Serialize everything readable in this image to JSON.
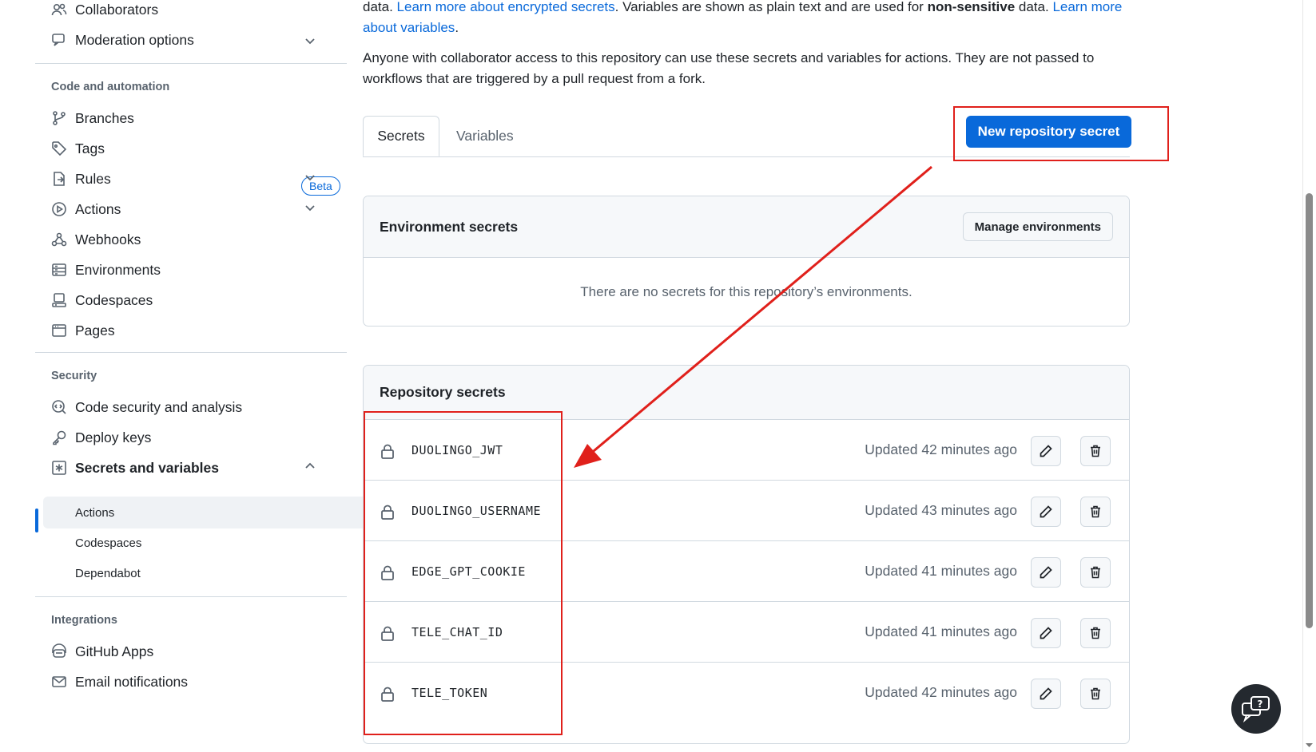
{
  "sidebar": {
    "top_items": [
      {
        "label": "Collaborators",
        "icon": "people-icon"
      },
      {
        "label": "Moderation options",
        "icon": "comment-icon"
      }
    ],
    "section_code": "Code and automation",
    "code_items": [
      {
        "label": "Branches",
        "icon": "git-branch-icon"
      },
      {
        "label": "Tags",
        "icon": "tag-icon"
      },
      {
        "label": "Rules",
        "icon": "rules-icon",
        "badge": "Beta"
      },
      {
        "label": "Actions",
        "icon": "play-icon"
      },
      {
        "label": "Webhooks",
        "icon": "webhook-icon"
      },
      {
        "label": "Environments",
        "icon": "server-icon"
      },
      {
        "label": "Codespaces",
        "icon": "codespaces-icon"
      },
      {
        "label": "Pages",
        "icon": "browser-icon"
      }
    ],
    "section_security": "Security",
    "security_items": [
      {
        "label": "Code security and analysis",
        "icon": "codescan-icon"
      },
      {
        "label": "Deploy keys",
        "icon": "key-icon"
      },
      {
        "label": "Secrets and variables",
        "icon": "asterisk-icon"
      }
    ],
    "secrets_subitems": [
      "Actions",
      "Codespaces",
      "Dependabot"
    ],
    "section_integrations": "Integrations",
    "integration_items": [
      {
        "label": "GitHub Apps",
        "icon": "hubot-icon"
      },
      {
        "label": "Email notifications",
        "icon": "mail-icon"
      }
    ]
  },
  "intro": {
    "line1_a": "data. ",
    "link_secrets": "Learn more about encrypted secrets",
    "line1_b": ". Variables are shown as plain text and are used for ",
    "bold": "non-sensitive",
    "line1_c": " data. ",
    "link_variables": "Learn more about variables",
    "line1_d": ".",
    "para2": "Anyone with collaborator access to this repository can use these secrets and variables for actions. They are not passed to workflows that are triggered by a pull request from a fork."
  },
  "tabs": [
    "Secrets",
    "Variables"
  ],
  "new_secret_button": "New repository secret",
  "environment_secrets": {
    "title": "Environment secrets",
    "manage_button": "Manage environments",
    "empty_text": "There are no secrets for this repository’s environments."
  },
  "repository_secrets": {
    "title": "Repository secrets",
    "rows": [
      {
        "name": "DUOLINGO_JWT",
        "updated": "Updated 42 minutes ago"
      },
      {
        "name": "DUOLINGO_USERNAME",
        "updated": "Updated 43 minutes ago"
      },
      {
        "name": "EDGE_GPT_COOKIE",
        "updated": "Updated 41 minutes ago"
      },
      {
        "name": "TELE_CHAT_ID",
        "updated": "Updated 41 minutes ago"
      },
      {
        "name": "TELE_TOKEN",
        "updated": "Updated 42 minutes ago"
      }
    ]
  },
  "colors": {
    "accent": "#0969da",
    "annotation": "#e0201b"
  }
}
